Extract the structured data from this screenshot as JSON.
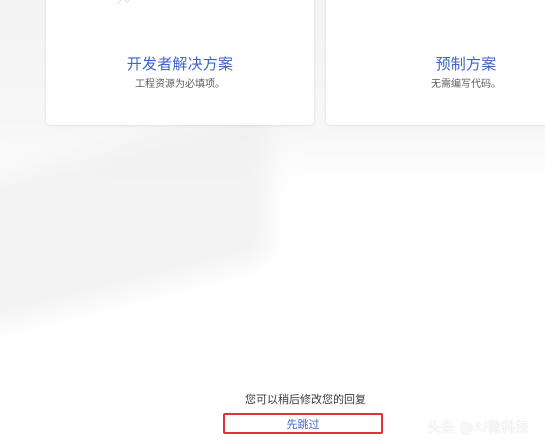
{
  "cards": {
    "developer": {
      "title": "开发者解决方案",
      "subtitle": "工程资源为必填项。"
    },
    "preset": {
      "title": "预制方案",
      "subtitle": "无需编写代码。"
    }
  },
  "footer": {
    "note": "您可以稍后修改您的回复",
    "skip_label": "先跳过"
  },
  "watermark": {
    "text": "头条 @AI微科技"
  },
  "colors": {
    "title_blue": "#3f63c8",
    "accent_orange": "#f4a61c",
    "highlight_red": "#e1323c"
  },
  "icons": {
    "developer": "developer-tool-icon",
    "preset": "preset-orange-icon"
  }
}
